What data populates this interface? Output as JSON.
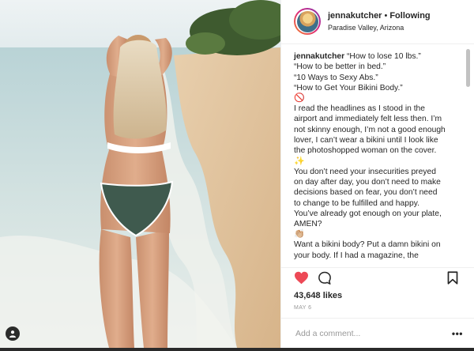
{
  "header": {
    "username": "jennakutcher",
    "separator": "•",
    "follow_status": "Following",
    "location": "Paradise Valley, Arizona"
  },
  "caption": {
    "username": "jennakutcher",
    "lines": [
      "“How to lose 10 lbs.”",
      "“How to be better in bed.”",
      "“10 Ways to Sexy Abs.”",
      "“How to Get Your Bikini Body.”",
      "🚫",
      "I read the headlines as I stood in the",
      "airport and immediately felt less then. I’m",
      "not skinny enough, I’m not a good enough",
      "lover, I can’t wear a bikini until I look like",
      "the photoshopped woman on the cover.",
      "✨",
      "You don’t need your insecurities preyed",
      "on day after day, you don’t need to make",
      "decisions based on fear, you don’t need",
      "to change to be fulfilled and happy.",
      "You’ve already got enough on your plate,",
      "AMEN?",
      "👏🏼",
      "Want a bikini body? Put a damn bikini on",
      "your body. If I had a magazine, the"
    ]
  },
  "actions": {
    "like_icon": "heart-filled-icon",
    "comment_icon": "comment-bubble-icon",
    "save_icon": "bookmark-icon"
  },
  "likes": "43,648 likes",
  "date": "MAY 6",
  "comment": {
    "placeholder": "Add a comment...",
    "more_label": "•••"
  },
  "photo": {
    "tag_icon": "user-tag-icon"
  },
  "colors": {
    "like": "#ed4956",
    "text": "#262626",
    "muted": "#999999",
    "border": "#efefef"
  }
}
